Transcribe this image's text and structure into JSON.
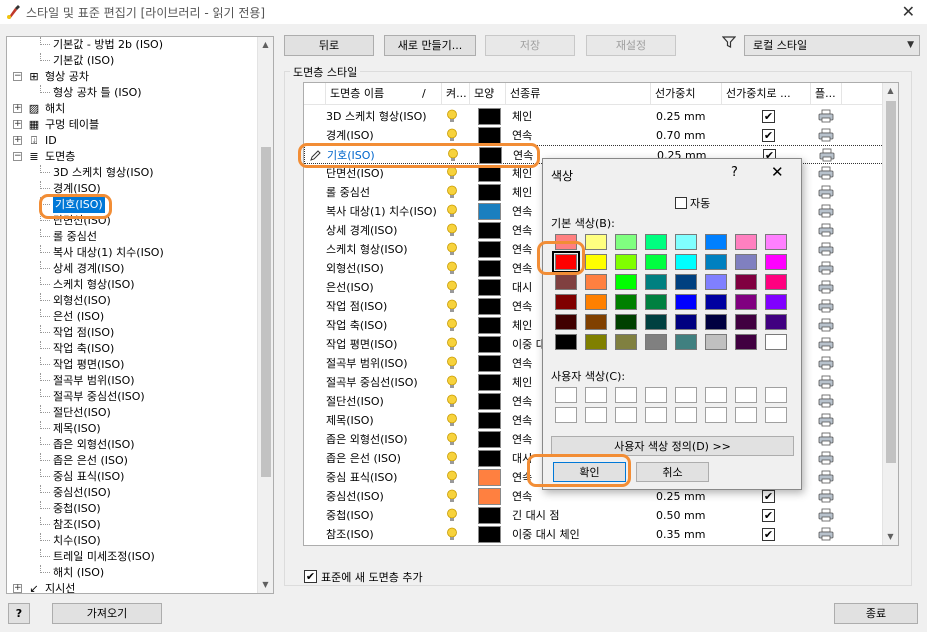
{
  "window": {
    "title": "스타일 및 표준 편집기 [라이브러리 - 읽기 전용]",
    "close_glyph": "✕"
  },
  "tree": {
    "items": [
      {
        "label": "기본값 - 방법 2b (ISO)",
        "level": 2
      },
      {
        "label": "기본값 (ISO)",
        "level": 2
      },
      {
        "label": "형상 공차",
        "level": 1,
        "expander": "⊟",
        "icon": "geometric-tolerance-icon",
        "glyph": "⊞"
      },
      {
        "label": "형상 공차 틀 (ISO)",
        "level": 2
      },
      {
        "label": "해치",
        "level": 1,
        "expander": "+",
        "icon": "hatch-icon",
        "glyph": "▨"
      },
      {
        "label": "구멍 테이블",
        "level": 1,
        "expander": "+",
        "icon": "hole-table-icon",
        "glyph": "▦"
      },
      {
        "label": "ID",
        "level": 1,
        "expander": "+",
        "icon": "id-icon",
        "glyph": "⍗"
      },
      {
        "label": "도면층",
        "level": 1,
        "expander": "⊟",
        "icon": "layers-icon",
        "glyph": "≣"
      },
      {
        "label": "3D 스케치 형상(ISO)",
        "level": 2
      },
      {
        "label": "경계(ISO)",
        "level": 2
      },
      {
        "label": "기호(ISO)",
        "level": 2,
        "selected": true
      },
      {
        "label": "단면선(ISO)",
        "level": 2
      },
      {
        "label": "롤 중심선",
        "level": 2
      },
      {
        "label": "복사 대상(1) 치수(ISO)",
        "level": 2
      },
      {
        "label": "상세 경계(ISO)",
        "level": 2
      },
      {
        "label": "스케치 형상(ISO)",
        "level": 2
      },
      {
        "label": "외형선(ISO)",
        "level": 2
      },
      {
        "label": "은선 (ISO)",
        "level": 2
      },
      {
        "label": "작업 점(ISO)",
        "level": 2
      },
      {
        "label": "작업 축(ISO)",
        "level": 2
      },
      {
        "label": "작업 평면(ISO)",
        "level": 2
      },
      {
        "label": "절곡부 범위(ISO)",
        "level": 2
      },
      {
        "label": "절곡부 중심선(ISO)",
        "level": 2
      },
      {
        "label": "절단선(ISO)",
        "level": 2
      },
      {
        "label": "제목(ISO)",
        "level": 2
      },
      {
        "label": "좁은 외형선(ISO)",
        "level": 2
      },
      {
        "label": "좁은 은선 (ISO)",
        "level": 2
      },
      {
        "label": "중심 표식(ISO)",
        "level": 2
      },
      {
        "label": "중심선(ISO)",
        "level": 2
      },
      {
        "label": "중첩(ISO)",
        "level": 2
      },
      {
        "label": "참조(ISO)",
        "level": 2
      },
      {
        "label": "치수(ISO)",
        "level": 2
      },
      {
        "label": "트레일 미세조정(ISO)",
        "level": 2
      },
      {
        "label": "해치 (ISO)",
        "level": 2
      },
      {
        "label": "지시선",
        "level": 1,
        "expander": "+",
        "icon": "leader-icon",
        "glyph": "↙"
      }
    ]
  },
  "toolbar": {
    "back": "뒤로",
    "new": "새로 만들기...",
    "save": "저장",
    "reset": "재설정",
    "filter_icon": "filter-icon",
    "style_filter": "로컬 스타일"
  },
  "layers": {
    "group_title": "도면층 스타일",
    "headers": [
      "도면층 이름",
      "/",
      "켜...",
      "모양",
      "선종류",
      "선가중치",
      "선가중치로 ...",
      "플..."
    ],
    "rows": [
      {
        "name": "3D 스케치 형상(ISO)",
        "color": "#000000",
        "linetype": "체인",
        "weight": "0.25 mm",
        "scale": true
      },
      {
        "name": "경계(ISO)",
        "color": "#000000",
        "linetype": "연속",
        "weight": "0.70 mm",
        "scale": true
      },
      {
        "name": "기호(ISO)",
        "color": "#000000",
        "linetype": "연속",
        "weight": "0.25 mm",
        "scale": true,
        "selected": true
      },
      {
        "name": "단면선(ISO)",
        "color": "#000000",
        "linetype": "체인",
        "weight": "",
        "scale": null
      },
      {
        "name": "롤 중심선",
        "color": "#000000",
        "linetype": "체인",
        "weight": "",
        "scale": null
      },
      {
        "name": "복사 대상(1) 치수(ISO)",
        "color": "#1a7fbf",
        "linetype": "연속",
        "weight": "",
        "scale": null
      },
      {
        "name": "상세 경계(ISO)",
        "color": "#000000",
        "linetype": "연속",
        "weight": "",
        "scale": null
      },
      {
        "name": "스케치 형상(ISO)",
        "color": "#000000",
        "linetype": "연속",
        "weight": "",
        "scale": null
      },
      {
        "name": "외형선(ISO)",
        "color": "#000000",
        "linetype": "연속",
        "weight": "",
        "scale": null
      },
      {
        "name": "은선(ISO)",
        "color": "#000000",
        "linetype": "대시",
        "weight": "",
        "scale": null
      },
      {
        "name": "작업 점(ISO)",
        "color": "#000000",
        "linetype": "연속",
        "weight": "",
        "scale": null
      },
      {
        "name": "작업 축(ISO)",
        "color": "#000000",
        "linetype": "체인",
        "weight": "",
        "scale": null
      },
      {
        "name": "작업 평면(ISO)",
        "color": "#000000",
        "linetype": "이중 대",
        "weight": "",
        "scale": null
      },
      {
        "name": "절곡부 범위(ISO)",
        "color": "#000000",
        "linetype": "연속",
        "weight": "",
        "scale": null
      },
      {
        "name": "절곡부 중심선(ISO)",
        "color": "#000000",
        "linetype": "체인",
        "weight": "",
        "scale": null
      },
      {
        "name": "절단선(ISO)",
        "color": "#000000",
        "linetype": "연속",
        "weight": "",
        "scale": null
      },
      {
        "name": "제목(ISO)",
        "color": "#000000",
        "linetype": "연속",
        "weight": "",
        "scale": null
      },
      {
        "name": "좁은 외형선(ISO)",
        "color": "#000000",
        "linetype": "연속",
        "weight": "",
        "scale": null
      },
      {
        "name": "좁은 은선 (ISO)",
        "color": "#000000",
        "linetype": "대시",
        "weight": "",
        "scale": null
      },
      {
        "name": "중심 표식(ISO)",
        "color": "#ff8040",
        "linetype": "연속",
        "weight": "",
        "scale": null
      },
      {
        "name": "중심선(ISO)",
        "color": "#ff8040",
        "linetype": "연속",
        "weight": "0.25 mm",
        "scale": true
      },
      {
        "name": "중첩(ISO)",
        "color": "#000000",
        "linetype": "긴 대시 점",
        "weight": "0.50 mm",
        "scale": true
      },
      {
        "name": "참조(ISO)",
        "color": "#000000",
        "linetype": "이중 대시 체인",
        "weight": "0.35 mm",
        "scale": true
      }
    ],
    "add_to_standard": "표준에 새 도면층 추가",
    "add_to_standard_checked": true
  },
  "footer": {
    "help": "?",
    "import": "가져오기",
    "close": "종료"
  },
  "color_dialog": {
    "title": "색상",
    "help": "?",
    "close": "✕",
    "auto": "자동",
    "basic_label": "기본 색상(B):",
    "custom_label": "사용자 색상(C):",
    "define_custom": "사용자 색상 정의(D) >>",
    "ok": "확인",
    "cancel": "취소",
    "selected_color": "#ff0000",
    "basic_colors": [
      [
        "#ff8080",
        "#ffff80",
        "#80ff80",
        "#00ff80",
        "#80ffff",
        "#0080ff",
        "#ff80c0",
        "#ff80ff"
      ],
      [
        "#ff0000",
        "#ffff00",
        "#80ff00",
        "#00ff40",
        "#00ffff",
        "#0080c0",
        "#8080c0",
        "#ff00ff"
      ],
      [
        "#804040",
        "#ff8040",
        "#00ff00",
        "#008080",
        "#004080",
        "#8080ff",
        "#800040",
        "#ff0080"
      ],
      [
        "#800000",
        "#ff8000",
        "#008000",
        "#008040",
        "#0000ff",
        "#0000a0",
        "#800080",
        "#8000ff"
      ],
      [
        "#400000",
        "#804000",
        "#004000",
        "#004040",
        "#000080",
        "#000040",
        "#400040",
        "#400080"
      ],
      [
        "#000000",
        "#808000",
        "#808040",
        "#808080",
        "#408080",
        "#c0c0c0",
        "#400040",
        "#ffffff"
      ]
    ]
  }
}
